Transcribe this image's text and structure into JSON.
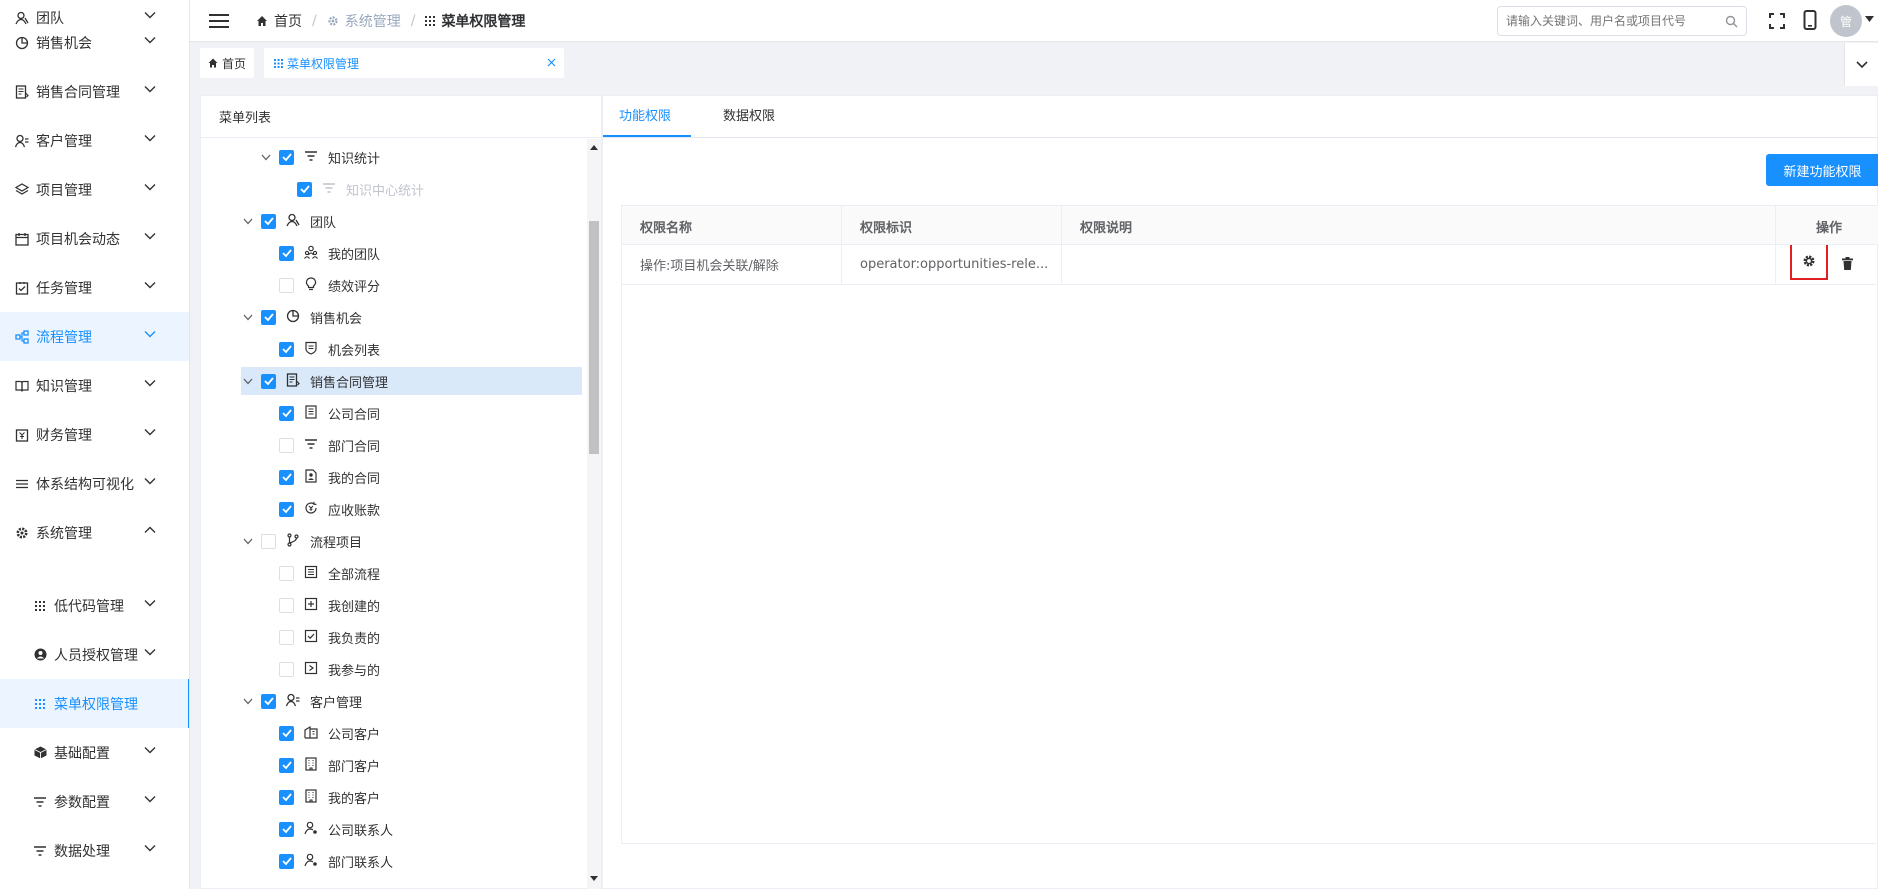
{
  "sidebar": {
    "items": [
      {
        "label": "团队",
        "icon": "team-icon"
      },
      {
        "label": "销售机会",
        "icon": "pie-icon"
      },
      {
        "label": "销售合同管理",
        "icon": "contract-icon"
      },
      {
        "label": "客户管理",
        "icon": "customer-icon"
      },
      {
        "label": "项目管理",
        "icon": "layers-icon"
      },
      {
        "label": "项目机会动态",
        "icon": "calendar-icon"
      },
      {
        "label": "任务管理",
        "icon": "task-icon"
      },
      {
        "label": "流程管理",
        "icon": "flow-icon"
      },
      {
        "label": "知识管理",
        "icon": "book-icon"
      },
      {
        "label": "财务管理",
        "icon": "finance-icon"
      },
      {
        "label": "体系结构可视化",
        "icon": "menu-lines-icon"
      },
      {
        "label": "系统管理",
        "icon": "gear-icon"
      }
    ],
    "sub_items": [
      {
        "label": "低代码管理",
        "icon": "grid-icon"
      },
      {
        "label": "人员授权管理",
        "icon": "user-circle-icon"
      },
      {
        "label": "菜单权限管理",
        "icon": "grid-icon"
      },
      {
        "label": "基础配置",
        "icon": "cube-icon"
      },
      {
        "label": "参数配置",
        "icon": "filter-icon"
      },
      {
        "label": "数据处理",
        "icon": "filter-icon"
      }
    ]
  },
  "header": {
    "breadcrumb": [
      "首页",
      "系统管理",
      "菜单权限管理"
    ],
    "search_placeholder": "请输入关键词、用户名或项目代号",
    "avatar_text": "管"
  },
  "tabs": [
    {
      "label": "首页"
    },
    {
      "label": "菜单权限管理"
    }
  ],
  "menu_panel": {
    "title": "菜单列表",
    "tree": [
      {
        "label": "知识统计",
        "level": 1,
        "checked": true,
        "icon": "filter-icon",
        "expanded": true
      },
      {
        "label": "知识中心统计",
        "level": 2,
        "checked": true,
        "icon": "filter-icon",
        "disabled": true
      },
      {
        "label": "团队",
        "level": 0,
        "checked": true,
        "icon": "team-icon",
        "expanded": true
      },
      {
        "label": "我的团队",
        "level": 1,
        "checked": true,
        "icon": "people-icon"
      },
      {
        "label": "绩效评分",
        "level": 1,
        "checked": false,
        "icon": "bulb-icon"
      },
      {
        "label": "销售机会",
        "level": 0,
        "checked": true,
        "icon": "pie-icon",
        "expanded": true
      },
      {
        "label": "机会列表",
        "level": 1,
        "checked": true,
        "icon": "shield-icon"
      },
      {
        "label": "销售合同管理",
        "level": 0,
        "checked": true,
        "icon": "contract-icon",
        "expanded": true,
        "highlighted": true
      },
      {
        "label": "公司合同",
        "level": 1,
        "checked": true,
        "icon": "doc-icon"
      },
      {
        "label": "部门合同",
        "level": 1,
        "checked": false,
        "icon": "filter-icon"
      },
      {
        "label": "我的合同",
        "level": 1,
        "checked": true,
        "icon": "user-doc-icon"
      },
      {
        "label": "应收账款",
        "level": 1,
        "checked": true,
        "icon": "refresh-coin-icon"
      },
      {
        "label": "流程项目",
        "level": 0,
        "checked": false,
        "icon": "branch-icon",
        "expanded": true
      },
      {
        "label": "全部流程",
        "level": 1,
        "checked": false,
        "icon": "list-icon"
      },
      {
        "label": "我创建的",
        "level": 1,
        "checked": false,
        "icon": "plus-square-icon"
      },
      {
        "label": "我负责的",
        "level": 1,
        "checked": false,
        "icon": "check-square-icon"
      },
      {
        "label": "我参与的",
        "level": 1,
        "checked": false,
        "icon": "play-square-icon"
      },
      {
        "label": "客户管理",
        "level": 0,
        "checked": true,
        "icon": "customer-icon",
        "expanded": true
      },
      {
        "label": "公司客户",
        "level": 1,
        "checked": true,
        "icon": "company-icon"
      },
      {
        "label": "部门客户",
        "level": 1,
        "checked": true,
        "icon": "building-icon"
      },
      {
        "label": "我的客户",
        "level": 1,
        "checked": true,
        "icon": "building-icon"
      },
      {
        "label": "公司联系人",
        "level": 1,
        "checked": true,
        "icon": "contact-icon"
      },
      {
        "label": "部门联系人",
        "level": 1,
        "checked": true,
        "icon": "contact-icon"
      }
    ]
  },
  "perm_panel": {
    "tabs": [
      "功能权限",
      "数据权限"
    ],
    "new_button": "新建功能权限",
    "columns": [
      "权限名称",
      "权限标识",
      "权限说明",
      "操作"
    ],
    "rows": [
      {
        "name": "操作:项目机会关联/解除",
        "key": "operator:opportunities-rele...",
        "desc": ""
      }
    ]
  },
  "colors": {
    "accent": "#1890ff",
    "highlight_box": "#e02020"
  }
}
